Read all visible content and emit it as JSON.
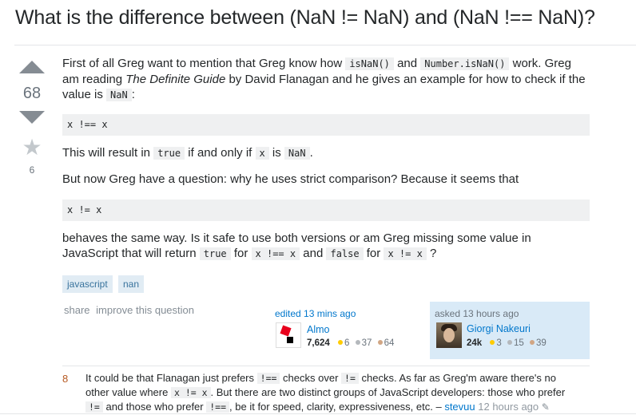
{
  "question": {
    "title": "What is the difference between (NaN != NaN) and (NaN !== NaN)?",
    "votes": "68",
    "favorites": "6",
    "body": {
      "p1_a": "First of all Greg want to mention that Greg know how",
      "p1_code1": "isNaN()",
      "p1_b": "and",
      "p1_code2": "Number.isNaN()",
      "p1_c": "work. Greg",
      "p1_line2_a": "am reading",
      "p1_book": "The Definite Guide",
      "p1_line2_b": "by David Flanagan and he gives an example for how to check if the",
      "p1_line3_a": "value is",
      "p1_code3": "NaN",
      "p1_line3_b": ":",
      "pre1": "x !== x",
      "p2_a": "This will result in",
      "p2_code1": "true",
      "p2_b": "if and only if",
      "p2_code2": "x",
      "p2_c": "is",
      "p2_code3": "NaN",
      "p2_d": ".",
      "p3": "But now Greg have a question: why he uses strict comparison? Because it seems that",
      "pre2": "x != x",
      "p4_line1": "behaves the same way. Is it safe to use both versions or am Greg missing some value in",
      "p4_a": "JavaScript that will return",
      "p4_code1": "true",
      "p4_b": "for",
      "p4_code2": "x !== x",
      "p4_c": "and",
      "p4_code3": "false",
      "p4_d": "for",
      "p4_code4": "x != x",
      "p4_e": "?"
    },
    "tags": [
      "javascript",
      "nan"
    ],
    "menu": {
      "share": "share",
      "improve": "improve this question"
    },
    "edited": {
      "label": "edited 13 mins ago",
      "user": "Almo",
      "rep": "7,624",
      "gold": "6",
      "silver": "37",
      "bronze": "64"
    },
    "asked": {
      "label": "asked 13 hours ago",
      "user": "Giorgi Nakeuri",
      "rep": "24k",
      "gold": "3",
      "silver": "15",
      "bronze": "39"
    }
  },
  "comment": {
    "score": "8",
    "t1": "It could be that Flanagan just prefers",
    "c1": "!==",
    "t2": "checks over",
    "c2": "!=",
    "t3": "checks. As far as Greg'm aware there's no other value where",
    "c3": "x != x",
    "t4": ". But there are two distinct groups of JavaScript developers: those who prefer",
    "c4": "!=",
    "t5": "and those who prefer",
    "c5": "!==",
    "t6": ", be it for speed, clarity, expressiveness, etc. –",
    "user": "stevuu",
    "time": "12 hours ago"
  },
  "colors": {
    "link": "#0077cc",
    "tag_bg": "#e1ecf4",
    "tag_text": "#39739d",
    "owner_bg": "#d9eaf7",
    "gold": "#ffcc01",
    "silver": "#b4b8bc",
    "bronze": "#d1a684"
  },
  "icons": {
    "upvote": "arrow-up-icon",
    "downvote": "arrow-down-icon",
    "favorite": "star-icon",
    "edit": "pencil-icon"
  }
}
